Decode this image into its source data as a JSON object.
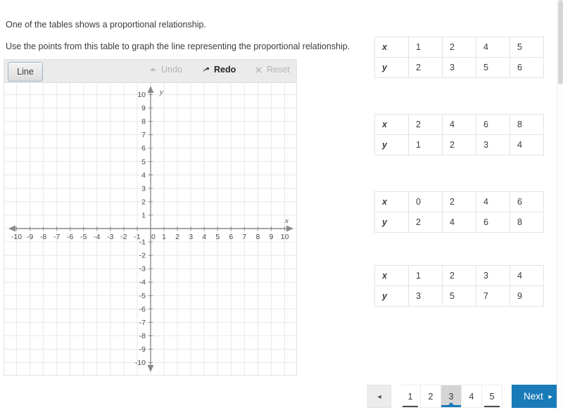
{
  "prompt": {
    "line1": "One of the tables shows a proportional relationship.",
    "line2": "Use the points from this table to graph the line representing the proportional relationship."
  },
  "grapher": {
    "toolbar": {
      "line_label": "Line",
      "undo_label": "Undo",
      "redo_label": "Redo",
      "reset_label": "Reset",
      "undo_icon": "undo-arrow-icon",
      "redo_icon": "redo-arrow-icon",
      "reset_icon": "close-x-icon"
    },
    "axes": {
      "x_label": "x",
      "y_label": "y",
      "x_min": -10,
      "x_max": 10,
      "y_min": -10,
      "y_max": 10,
      "x_ticks": [
        "-10",
        "-9",
        "-8",
        "-7",
        "-6",
        "-5",
        "-4",
        "-3",
        "-2",
        "-1",
        "0",
        "1",
        "2",
        "3",
        "4",
        "5",
        "6",
        "7",
        "8",
        "9",
        "10"
      ],
      "y_ticks": [
        "10",
        "9",
        "8",
        "7",
        "6",
        "5",
        "4",
        "3",
        "2",
        "1",
        "0",
        "-1",
        "-2",
        "-3",
        "-4",
        "-5",
        "-6",
        "-7",
        "-8",
        "-9",
        "-10"
      ],
      "grid": true,
      "grid_color": "#e8e8e8",
      "axis_color": "#8a8a8a"
    }
  },
  "tables": [
    {
      "var_x": "x",
      "var_y": "y",
      "x_values": [
        "1",
        "2",
        "4",
        "5"
      ],
      "y_values": [
        "2",
        "3",
        "5",
        "6"
      ]
    },
    {
      "var_x": "x",
      "var_y": "y",
      "x_values": [
        "2",
        "4",
        "6",
        "8"
      ],
      "y_values": [
        "1",
        "2",
        "3",
        "4"
      ]
    },
    {
      "var_x": "x",
      "var_y": "y",
      "x_values": [
        "0",
        "2",
        "4",
        "6"
      ],
      "y_values": [
        "2",
        "4",
        "6",
        "8"
      ]
    },
    {
      "var_x": "x",
      "var_y": "y",
      "x_values": [
        "1",
        "2",
        "3",
        "4"
      ],
      "y_values": [
        "3",
        "5",
        "7",
        "9"
      ]
    }
  ],
  "pagination": {
    "prev_glyph": "◄",
    "pages": [
      {
        "label": "1",
        "state": "visited"
      },
      {
        "label": "2",
        "state": "unvisited"
      },
      {
        "label": "3",
        "state": "current"
      },
      {
        "label": "4",
        "state": "unvisited"
      },
      {
        "label": "5",
        "state": "visited"
      }
    ],
    "next_label": "Next",
    "next_glyph": "►",
    "accent_color": "#1a7bb9"
  }
}
